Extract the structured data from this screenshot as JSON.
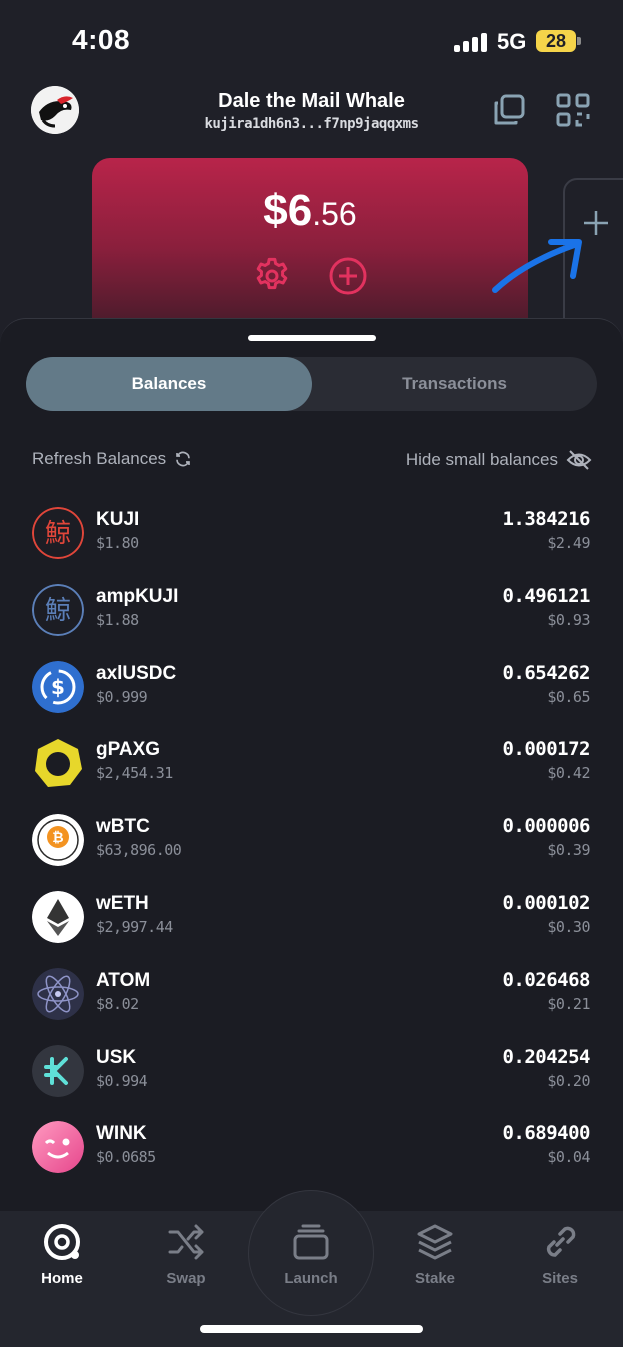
{
  "status_bar": {
    "time": "4:08",
    "network": "5G",
    "battery": "28"
  },
  "header": {
    "wallet_name": "Dale the Mail Whale",
    "address": "kujira1dh6n3...f7np9jaqqxms"
  },
  "card": {
    "balance_whole": "$6",
    "balance_cents": ".56"
  },
  "tabs": {
    "balances": "Balances",
    "transactions": "Transactions"
  },
  "toolbar": {
    "refresh": "Refresh Balances",
    "hide_small": "Hide small balances"
  },
  "tokens": [
    {
      "symbol": "KUJI",
      "price": "$1.80",
      "amount": "1.384216",
      "value": "$2.49",
      "icon": "kuji-icon"
    },
    {
      "symbol": "ampKUJI",
      "price": "$1.88",
      "amount": "0.496121",
      "value": "$0.93",
      "icon": "ampkuji-icon"
    },
    {
      "symbol": "axlUSDC",
      "price": "$0.999",
      "amount": "0.654262",
      "value": "$0.65",
      "icon": "usdc-icon"
    },
    {
      "symbol": "gPAXG",
      "price": "$2,454.31",
      "amount": "0.000172",
      "value": "$0.42",
      "icon": "paxg-icon"
    },
    {
      "symbol": "wBTC",
      "price": "$63,896.00",
      "amount": "0.000006",
      "value": "$0.39",
      "icon": "wbtc-icon"
    },
    {
      "symbol": "wETH",
      "price": "$2,997.44",
      "amount": "0.000102",
      "value": "$0.30",
      "icon": "eth-icon"
    },
    {
      "symbol": "ATOM",
      "price": "$8.02",
      "amount": "0.026468",
      "value": "$0.21",
      "icon": "atom-icon"
    },
    {
      "symbol": "USK",
      "price": "$0.994",
      "amount": "0.204254",
      "value": "$0.20",
      "icon": "usk-icon"
    },
    {
      "symbol": "WINK",
      "price": "$0.0685",
      "amount": "0.689400",
      "value": "$0.04",
      "icon": "wink-icon"
    }
  ],
  "nav": {
    "home": "Home",
    "swap": "Swap",
    "launch": "Launch",
    "stake": "Stake",
    "sites": "Sites"
  },
  "colors": {
    "background": "#1f2028",
    "accent": "#c2254f",
    "tab_active": "#637a88",
    "annotation": "#1a73e8"
  }
}
